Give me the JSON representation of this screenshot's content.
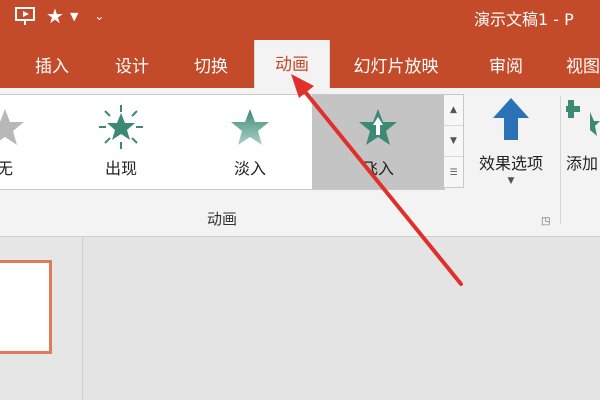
{
  "window": {
    "title": "演示文稿1 - P"
  },
  "quick_access": [
    {
      "icon": "present-from-start-icon"
    },
    {
      "icon": "star-icon"
    },
    {
      "icon": "customize-qat-icon"
    }
  ],
  "tabs": [
    {
      "label": "插入"
    },
    {
      "label": "设计"
    },
    {
      "label": "切换"
    },
    {
      "label": "动画",
      "active": true
    },
    {
      "label": "幻灯片放映"
    },
    {
      "label": "审阅"
    },
    {
      "label": "视图"
    }
  ],
  "animation_gallery": {
    "items": [
      {
        "label": "无",
        "icon": "star-outline-icon"
      },
      {
        "label": "出现",
        "icon": "star-burst-icon"
      },
      {
        "label": "淡入",
        "icon": "star-fade-icon"
      },
      {
        "label": "飞入",
        "icon": "star-fly-in-icon",
        "selected": true
      }
    ]
  },
  "effect_options": {
    "label": "效果选项",
    "icon": "up-arrow-icon"
  },
  "add_animation": {
    "label": "添加",
    "icon": "add-animation-icon"
  },
  "group": {
    "label": "动画"
  },
  "colors": {
    "accent": "#c44b2a",
    "star_green": "#3c8a74",
    "arrow_blue": "#2a71b5",
    "annotation_red": "#e0302c"
  }
}
